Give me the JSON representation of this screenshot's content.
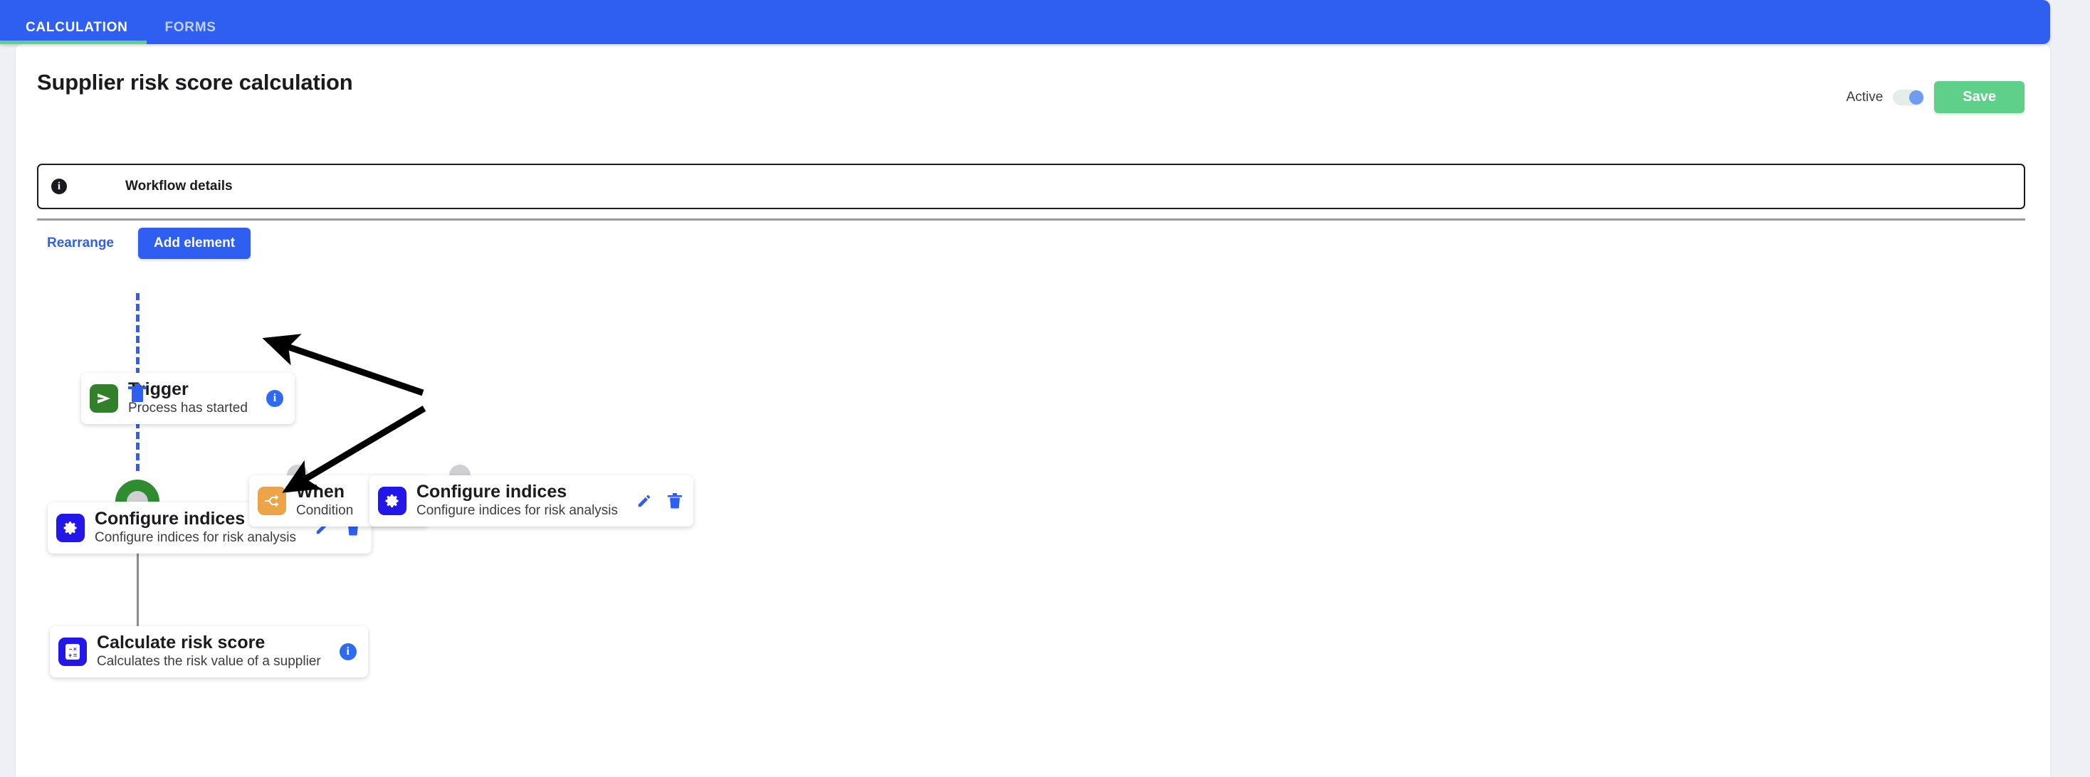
{
  "tabs": [
    {
      "label": "CALCULATION",
      "active": true
    },
    {
      "label": "FORMS",
      "active": false
    }
  ],
  "header": {
    "title": "Supplier risk score calculation",
    "active_label": "Active",
    "active_toggle_state": "on",
    "save_label": "Save",
    "save_color": "#5fd08a"
  },
  "workflow_details": {
    "label": "Workflow details",
    "icon": "info-icon"
  },
  "toolbar": {
    "rearrange_label": "Rearrange",
    "add_element_label": "Add element",
    "accent_color": "#2f5ff0"
  },
  "canvas": {
    "nodes": [
      {
        "id": "trigger",
        "title": "Trigger",
        "subtitle": "Process has started",
        "icon": "send-icon",
        "icon_color": "#33802b",
        "actions": [
          "info-icon"
        ]
      },
      {
        "id": "configure-indices-main",
        "title": "Configure indices",
        "subtitle": "Configure indices for risk analysis",
        "icon": "gear-icon",
        "icon_color": "#2316e8",
        "actions": [
          "edit-icon",
          "delete-icon"
        ]
      },
      {
        "id": "when-floating",
        "title": "When",
        "subtitle": "Condition",
        "icon": "branch-icon",
        "icon_color": "#eda449",
        "actions": [
          "edit-icon",
          "delete-icon"
        ]
      },
      {
        "id": "configure-indices-floating",
        "title": "Configure indices",
        "subtitle": "Configure indices for risk analysis",
        "icon": "gear-icon",
        "icon_color": "#2316e8",
        "actions": [
          "edit-icon",
          "delete-icon"
        ]
      },
      {
        "id": "calculate-risk-score",
        "title": "Calculate risk score",
        "subtitle": "Calculates the risk value of a supplier",
        "icon": "calculator-icon",
        "icon_color": "#2316e8",
        "actions": [
          "info-icon"
        ]
      }
    ],
    "connectors": [
      {
        "id": "trigger-to-configure",
        "style": "dashed",
        "color": "#2f5ff0",
        "has_delete_handle": true
      },
      {
        "id": "configure-to-calculate",
        "style": "solid",
        "color": "#8a8a90",
        "has_delete_handle": false
      }
    ],
    "drop_target_color": "#2f8c2f"
  }
}
